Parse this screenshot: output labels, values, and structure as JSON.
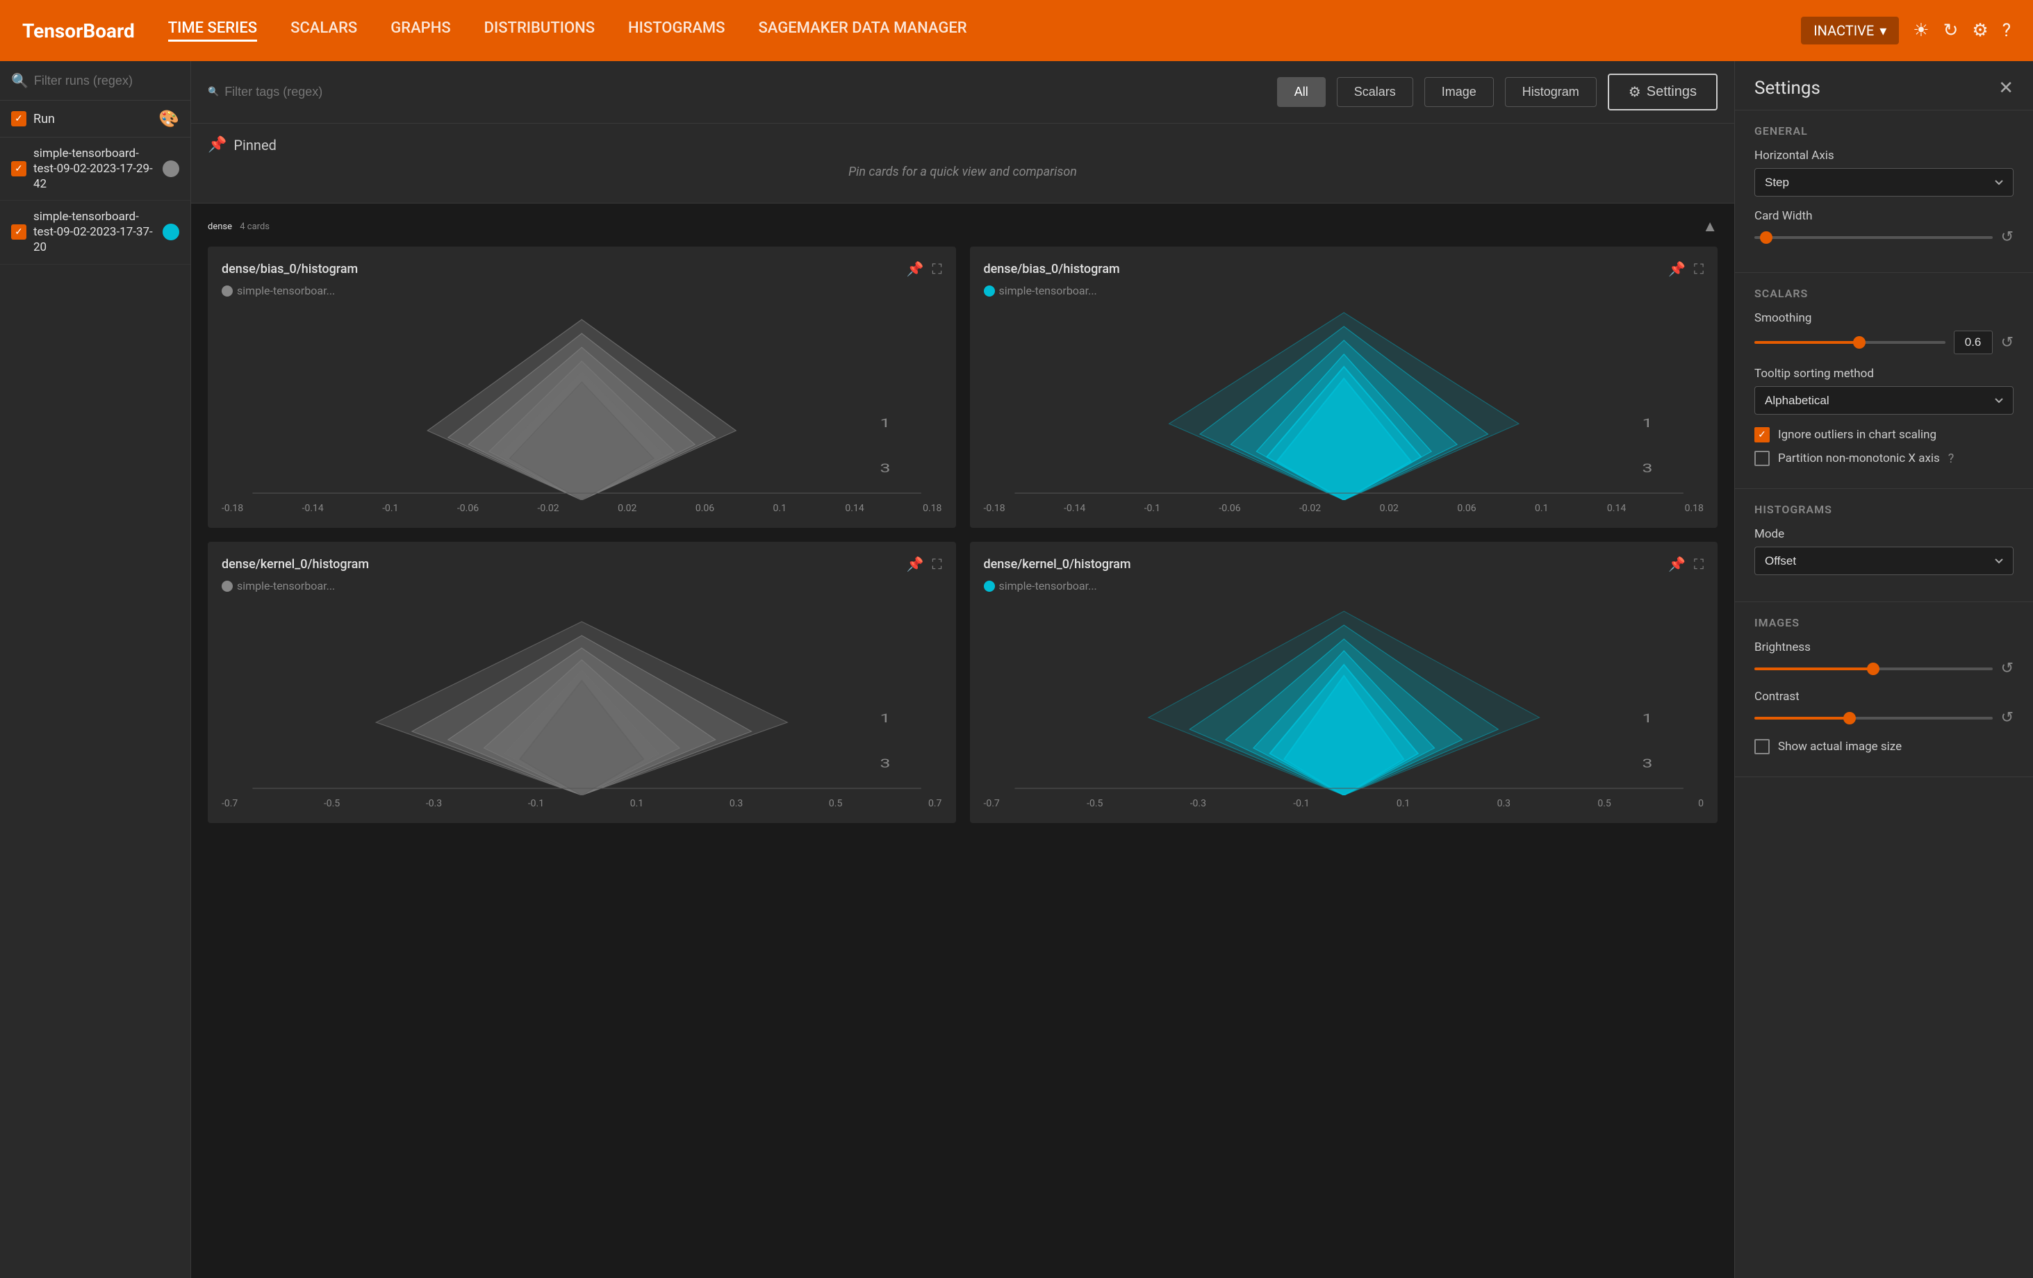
{
  "nav": {
    "brand": "TensorBoard",
    "items": [
      {
        "id": "time-series",
        "label": "TIME SERIES",
        "active": true
      },
      {
        "id": "scalars",
        "label": "SCALARS",
        "active": false
      },
      {
        "id": "graphs",
        "label": "GRAPHS",
        "active": false
      },
      {
        "id": "distributions",
        "label": "DISTRIBUTIONS",
        "active": false
      },
      {
        "id": "histograms",
        "label": "HISTOGRAMS",
        "active": false
      },
      {
        "id": "sagemaker",
        "label": "SAGEMAKER DATA MANAGER",
        "active": false
      }
    ],
    "status": "INACTIVE",
    "icons": [
      "sun-icon",
      "refresh-icon",
      "settings-icon",
      "help-icon"
    ]
  },
  "sidebar": {
    "search_placeholder": "Filter runs (regex)",
    "run_label": "Run",
    "runs": [
      {
        "name": "simple-tensorboard-test-09-02-2023-17-29-42",
        "color": "gray"
      },
      {
        "name": "simple-tensorboard-test-09-02-2023-17-37-20",
        "color": "cyan"
      }
    ]
  },
  "toolbar": {
    "search_placeholder": "Filter tags (regex)",
    "filter_buttons": [
      "All",
      "Scalars",
      "Image",
      "Histogram"
    ],
    "settings_label": "Settings"
  },
  "pinned": {
    "title": "Pinned",
    "empty_text": "Pin cards for a quick view and comparison"
  },
  "sections": [
    {
      "name": "dense",
      "count": "4 cards",
      "cards": [
        {
          "id": "bias-gray",
          "title": "dense/bias_0/histogram",
          "subtitle": "simple-tensorboar...",
          "color": "gray",
          "x_labels": [
            "-0.18",
            "-0.14",
            "-0.1",
            "-0.06",
            "-0.02",
            "0.02",
            "0.06",
            "0.1",
            "0.14",
            "0.18"
          ],
          "y_labels": [
            "1",
            "3"
          ]
        },
        {
          "id": "bias-cyan",
          "title": "dense/bias_0/histogram",
          "subtitle": "simple-tensorboar...",
          "color": "cyan",
          "x_labels": [
            "-0.18",
            "-0.14",
            "-0.1",
            "-0.06",
            "-0.02",
            "0.02",
            "0.06",
            "0.1",
            "0.14",
            "0.18"
          ],
          "y_labels": [
            "1",
            "3"
          ]
        },
        {
          "id": "kernel-gray",
          "title": "dense/kernel_0/histogram",
          "subtitle": "simple-tensorboar...",
          "color": "gray",
          "x_labels": [
            "-0.7",
            "-0.5",
            "-0.3",
            "-0.1",
            "0.1",
            "0.3",
            "0.5",
            "0.7"
          ],
          "y_labels": [
            "1",
            "3"
          ]
        },
        {
          "id": "kernel-cyan",
          "title": "dense/kernel_0/histogram",
          "subtitle": "simple-tensorboar...",
          "color": "cyan",
          "x_labels": [
            "-0.7",
            "-0.5",
            "-0.3",
            "-0.1",
            "0.1",
            "0.3",
            "0.5",
            "0"
          ],
          "y_labels": [
            "1",
            "3"
          ]
        }
      ]
    }
  ],
  "settings": {
    "title": "Settings",
    "general": {
      "section_title": "GENERAL",
      "horizontal_axis_label": "Horizontal Axis",
      "horizontal_axis_value": "Step",
      "card_width_label": "Card Width"
    },
    "scalars": {
      "section_title": "SCALARS",
      "smoothing_label": "Smoothing",
      "smoothing_value": "0.6",
      "tooltip_sort_label": "Tooltip sorting method",
      "tooltip_sort_value": "Alphabetical",
      "ignore_outliers_label": "Ignore outliers in chart scaling",
      "ignore_outliers_checked": true,
      "partition_label": "Partition non-monotonic X axis",
      "partition_checked": false
    },
    "histograms": {
      "section_title": "HISTOGRAMS",
      "mode_label": "Mode",
      "mode_value": "Offset"
    },
    "images": {
      "section_title": "IMAGES",
      "brightness_label": "Brightness",
      "contrast_label": "Contrast",
      "show_actual_size_label": "Show actual image size",
      "show_actual_size_checked": false
    }
  }
}
